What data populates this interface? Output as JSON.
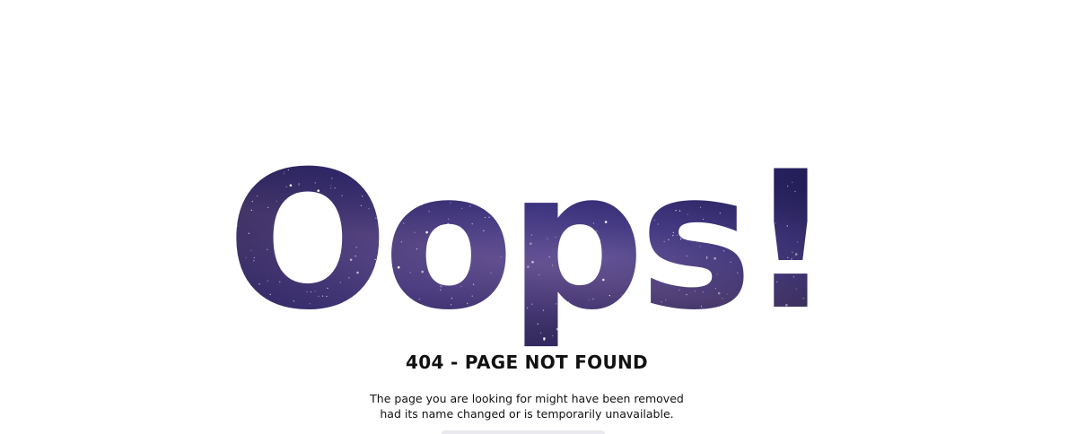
{
  "hero": {
    "headline": "Oops!"
  },
  "error": {
    "code_text": "404 - PAGE NOT FOUND",
    "message_line1": "The page you are looking for might have been removed",
    "message_line2": "had its name changed or is temporarily unavailable."
  },
  "colors": {
    "background": "#ffffff",
    "text": "#111111",
    "galaxy_dark": "#0b0a1e",
    "galaxy_mid": "#2c2670",
    "galaxy_glow": "#5b4c9c"
  }
}
